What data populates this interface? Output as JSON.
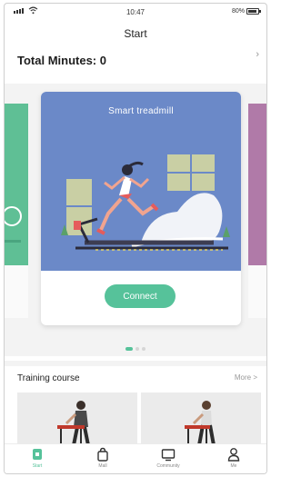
{
  "status_bar": {
    "time": "10:47",
    "battery": "80%"
  },
  "header": {
    "title": "Start"
  },
  "summary": {
    "total_label": "Total Minutes: 0"
  },
  "carousel": {
    "card_title": "Smart treadmill",
    "connect_label": "Connect",
    "page_count": 3,
    "active_index": 0
  },
  "training": {
    "title": "Training course",
    "more_label": "More >"
  },
  "tabbar": {
    "items": [
      {
        "label": "Start",
        "icon": "start-icon",
        "active": true
      },
      {
        "label": "Mall",
        "icon": "bag-icon",
        "active": false
      },
      {
        "label": "Community",
        "icon": "monitor-icon",
        "active": false
      },
      {
        "label": "Me",
        "icon": "person-icon",
        "active": false
      }
    ]
  },
  "colors": {
    "accent": "#56c29a",
    "card_bg": "#6b89c8",
    "left_card": "#5fbf95",
    "right_card": "#b07aa8"
  }
}
